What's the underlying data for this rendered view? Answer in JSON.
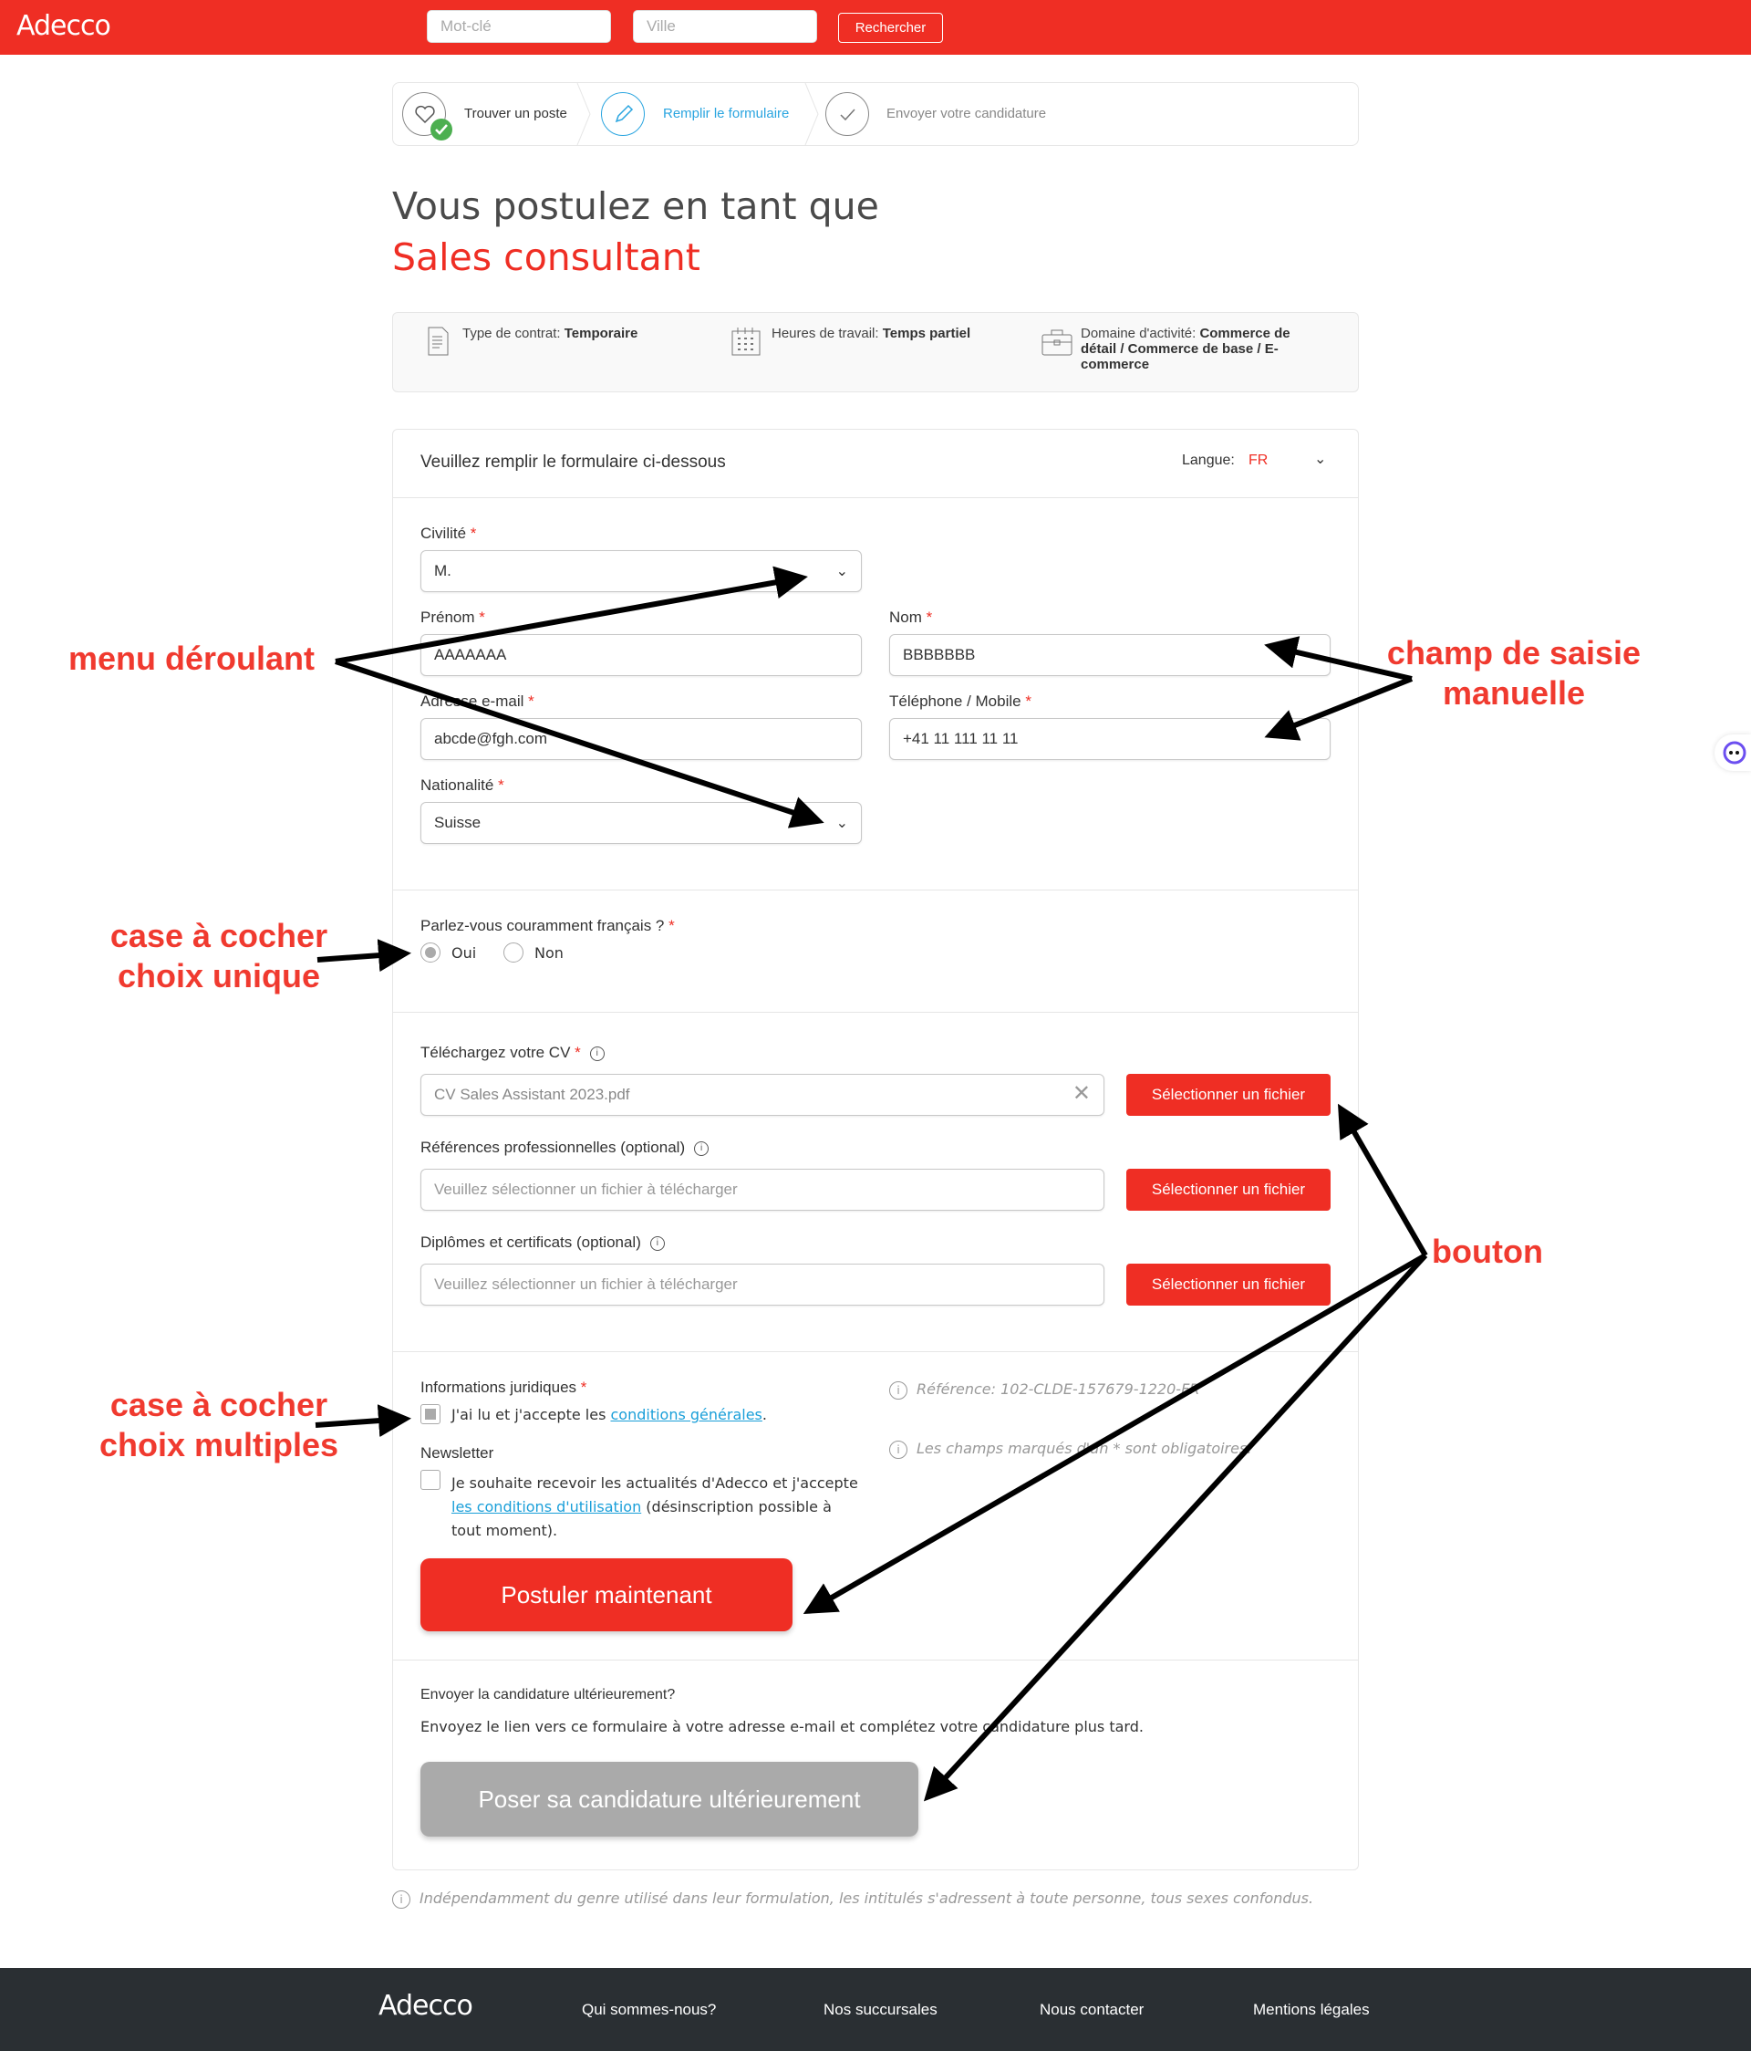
{
  "header": {
    "logo": "Adecco",
    "keyword_placeholder": "Mot-clé",
    "city_placeholder": "Ville",
    "search_button": "Rechercher",
    "brand_color": "#ef2e24"
  },
  "stepper": {
    "steps": [
      {
        "label": "Trouver un poste",
        "state": "completed",
        "icon": "heart-icon"
      },
      {
        "label": "Remplir le formulaire",
        "state": "active",
        "icon": "pencil-icon"
      },
      {
        "label": "Envoyer votre candidature",
        "state": "pending",
        "icon": "check-icon"
      }
    ]
  },
  "title": {
    "line1": "Vous postulez en tant que",
    "job": "Sales consultant"
  },
  "job_info": [
    {
      "label": "Type de contrat:",
      "value": "Temporaire",
      "icon": "document-icon"
    },
    {
      "label": "Heures de travail:",
      "value": "Temps partiel",
      "icon": "calendar-icon"
    },
    {
      "label": "Domaine d'activité:",
      "value": "Commerce de détail / Commerce de base / E-commerce",
      "icon": "briefcase-icon"
    }
  ],
  "form": {
    "header": "Veuillez remplir le formulaire ci-dessous",
    "language_label": "Langue:",
    "language_value": "FR",
    "required_mark": "*",
    "civilite": {
      "label": "Civilité",
      "value": "M."
    },
    "prenom": {
      "label": "Prénom",
      "value": "AAAAAAA"
    },
    "nom": {
      "label": "Nom",
      "value": "BBBBBBB"
    },
    "email": {
      "label": "Adresse e-mail",
      "value": "abcde@fgh.com"
    },
    "telephone": {
      "label": "Téléphone / Mobile",
      "value": "+41 11 111 11 11"
    },
    "nationalite": {
      "label": "Nationalité",
      "value": "Suisse"
    },
    "french": {
      "question": "Parlez-vous couramment français  ?",
      "options": [
        "Oui",
        "Non"
      ],
      "selected": "Oui"
    },
    "uploads": [
      {
        "label": "Téléchargez votre CV",
        "required": true,
        "value": "CV Sales Assistant 2023.pdf",
        "placeholder": "",
        "button": "Sélectionner un fichier"
      },
      {
        "label": "Références professionnelles (optional)",
        "required": false,
        "value": "",
        "placeholder": "Veuillez sélectionner un fichier à télécharger",
        "button": "Sélectionner un fichier"
      },
      {
        "label": "Diplômes et certificats (optional)",
        "required": false,
        "value": "",
        "placeholder": "Veuillez sélectionner un fichier à télécharger",
        "button": "Sélectionner un fichier"
      }
    ],
    "legal": {
      "label": "Informations juridiques",
      "text_before": "J'ai lu et j'accepte les ",
      "link": "conditions générales",
      "text_after": ".",
      "checked": true
    },
    "newsletter": {
      "label": "Newsletter",
      "text_before": "Je souhaite recevoir les actualités d'Adecco et j'accepte",
      "link": "les conditions d'utilisation",
      "text_after": " (désinscription possible à",
      "text_line3": "tout moment).",
      "checked": false
    },
    "reference": "Référence: 102-CLDE-157679-1220-FR",
    "mandatory_note": "Les champs marqués d'un * sont obligatoires.",
    "submit_button": "Postuler maintenant",
    "later": {
      "title": "Envoyer la candidature ultérieurement?",
      "description": "Envoyez le lien vers ce formulaire à votre adresse e-mail et complétez votre candidature plus tard.",
      "button": "Poser sa candidature ultérieurement"
    }
  },
  "gender_note": "Indépendamment du genre utilisé dans leur formulation, les intitulés s'adressent à toute personne, tous sexes confondus.",
  "footer": {
    "logo": "Adecco",
    "links": [
      "Qui sommes-nous?",
      "Nos succursales",
      "Nous contacter",
      "Mentions légales"
    ]
  },
  "annotations": {
    "dropdown": "menu déroulant",
    "text_field_1": "champ de saisie",
    "text_field_2": "manuelle",
    "radio_1": "case à cocher",
    "radio_2": "choix unique",
    "button": "bouton",
    "checkbox_1": "case à cocher",
    "checkbox_2": "choix multiples"
  }
}
